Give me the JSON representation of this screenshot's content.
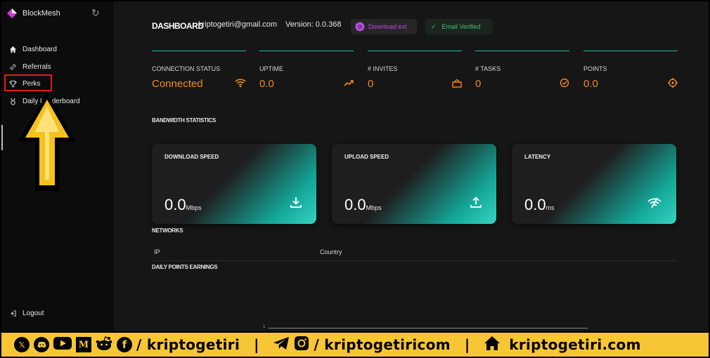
{
  "app": {
    "name": "BlockMesh"
  },
  "sidebar": {
    "items": [
      {
        "label": "Dashboard",
        "icon": "home-icon"
      },
      {
        "label": "Referrals",
        "icon": "link-icon"
      },
      {
        "label": "Perks",
        "icon": "trophy-icon"
      },
      {
        "label": "Daily Leaderboard",
        "icon": "medal-icon"
      }
    ],
    "logout": "Logout"
  },
  "header": {
    "title": "DASHBOARD",
    "email": "kriptogetiri@gmail.com",
    "version": "Version: 0.0.368",
    "download_ext": "Download ext",
    "email_verified": "Email Verified"
  },
  "stats": [
    {
      "label": "CONNECTION STATUS",
      "value": "Connected",
      "icon": "wifi-icon"
    },
    {
      "label": "UPTIME",
      "value": "0.0",
      "icon": "trending-up-icon"
    },
    {
      "label": "# INVITES",
      "value": "0",
      "icon": "invites-icon"
    },
    {
      "label": "# TASKS",
      "value": "0",
      "icon": "check-circle-icon"
    },
    {
      "label": "POINTS",
      "value": "0.0",
      "icon": "target-icon"
    }
  ],
  "bandwidth": {
    "heading": "BANDWIDTH STATISTICS",
    "cards": [
      {
        "label": "DOWNLOAD SPEED",
        "value": "0.0",
        "unit": "Mbps",
        "icon": "download-icon"
      },
      {
        "label": "UPLOAD SPEED",
        "value": "0.0",
        "unit": "Mbps",
        "icon": "upload-icon"
      },
      {
        "label": "LATENCY",
        "value": "0.0",
        "unit": "ms",
        "icon": "signal-icon"
      }
    ]
  },
  "networks": {
    "heading": "NETWORKS",
    "columns": [
      "IP",
      "Country"
    ]
  },
  "daily_points": {
    "heading": "DAILY POINTS EARNINGS",
    "axis_tick": "1"
  },
  "footer": {
    "handle1": "/ kriptogetiri",
    "sep": "|",
    "handle2": "/ kriptogetiricom",
    "site": "kriptogetiri.com"
  },
  "colors": {
    "accent": "#f08a24",
    "teal": "#2cb5a8",
    "banner": "#f7c634"
  }
}
